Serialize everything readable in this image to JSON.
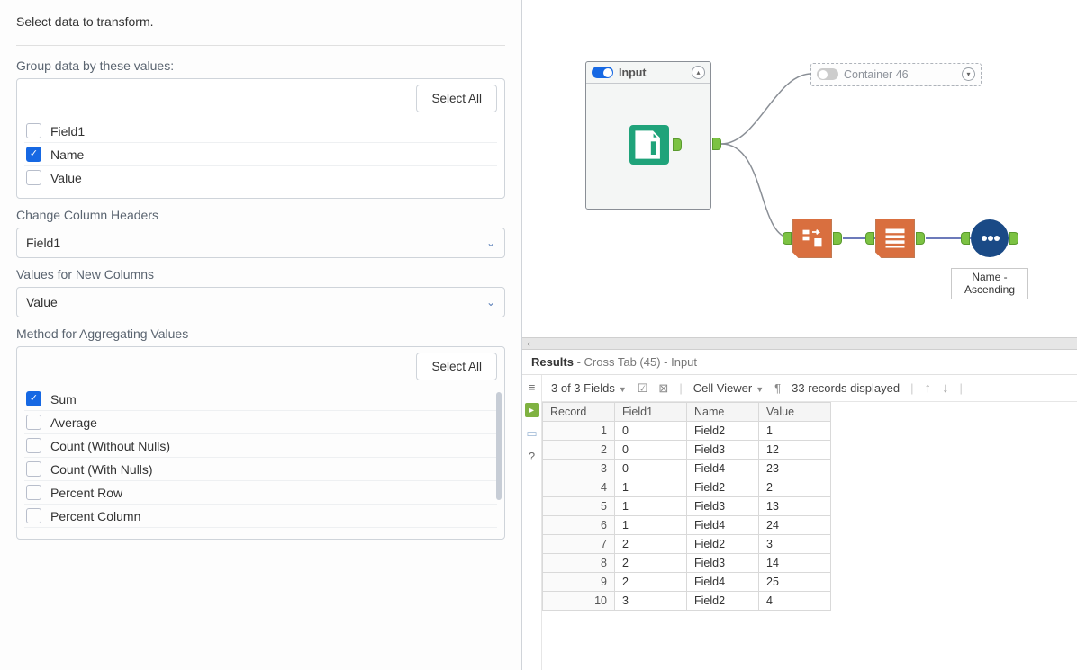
{
  "left": {
    "instruction": "Select data to transform.",
    "group_label": "Group data by these values:",
    "select_all": "Select All",
    "group_fields": [
      {
        "label": "Field1",
        "checked": false
      },
      {
        "label": "Name",
        "checked": true
      },
      {
        "label": "Value",
        "checked": false
      }
    ],
    "change_headers_label": "Change Column Headers",
    "change_headers_value": "Field1",
    "values_new_label": "Values for New Columns",
    "values_new_value": "Value",
    "agg_label": "Method for Aggregating Values",
    "agg_methods": [
      {
        "label": "Sum",
        "checked": true
      },
      {
        "label": "Average",
        "checked": false
      },
      {
        "label": "Count (Without Nulls)",
        "checked": false
      },
      {
        "label": "Count (With Nulls)",
        "checked": false
      },
      {
        "label": "Percent Row",
        "checked": false
      },
      {
        "label": "Percent Column",
        "checked": false
      }
    ]
  },
  "canvas": {
    "input_container": "Input",
    "disabled_container": "Container 46",
    "sort_label": "Name - Ascending"
  },
  "results": {
    "title": "Results",
    "subtitle": "- Cross Tab (45) - Input",
    "fields_text": "3 of 3 Fields",
    "cell_viewer": "Cell Viewer",
    "records_text": "33 records displayed",
    "columns": [
      "Record",
      "Field1",
      "Name",
      "Value"
    ],
    "rows": [
      [
        1,
        "0",
        "Field2",
        "1"
      ],
      [
        2,
        "0",
        "Field3",
        "12"
      ],
      [
        3,
        "0",
        "Field4",
        "23"
      ],
      [
        4,
        "1",
        "Field2",
        "2"
      ],
      [
        5,
        "1",
        "Field3",
        "13"
      ],
      [
        6,
        "1",
        "Field4",
        "24"
      ],
      [
        7,
        "2",
        "Field2",
        "3"
      ],
      [
        8,
        "2",
        "Field3",
        "14"
      ],
      [
        9,
        "2",
        "Field4",
        "25"
      ],
      [
        10,
        "3",
        "Field2",
        "4"
      ]
    ]
  }
}
